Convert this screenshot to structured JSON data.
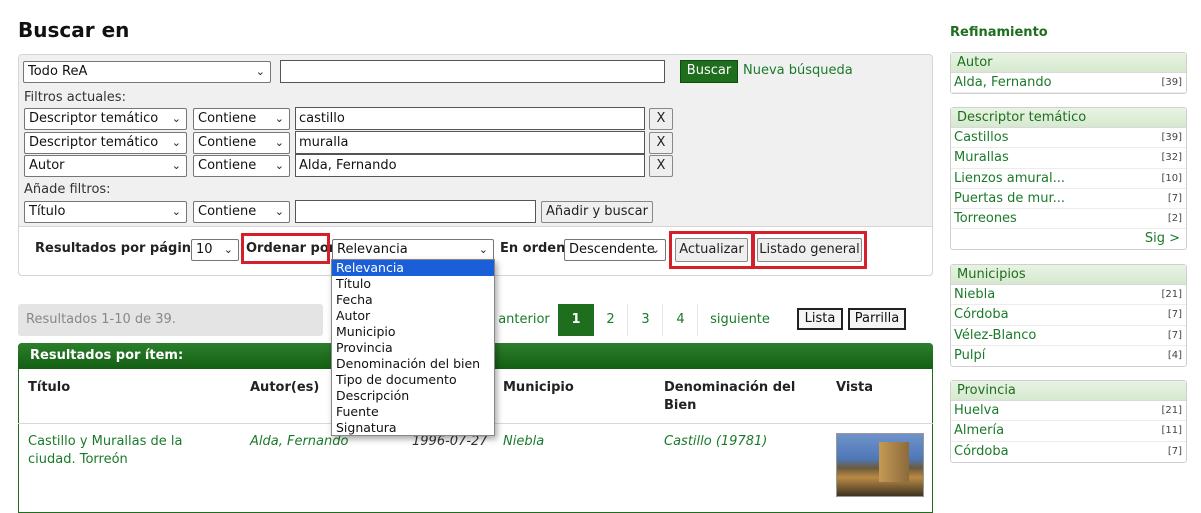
{
  "page": {
    "title": "Buscar en"
  },
  "search": {
    "scope": "Todo ReA",
    "query": "",
    "search_button": "Buscar",
    "new_search": "Nueva búsqueda"
  },
  "filters": {
    "current_label": "Filtros actuales:",
    "rows": [
      {
        "field": "Descriptor temático",
        "op": "Contiene",
        "value": "castillo",
        "remove": "X"
      },
      {
        "field": "Descriptor temático",
        "op": "Contiene",
        "value": "muralla",
        "remove": "X"
      },
      {
        "field": "Autor",
        "op": "Contiene",
        "value": "Alda, Fernando",
        "remove": "X"
      }
    ],
    "add_label": "Añade filtros:",
    "add_row": {
      "field": "Título",
      "op": "Contiene",
      "value": "",
      "button": "Añadir y buscar"
    }
  },
  "options": {
    "per_page_label": "Resultados por página",
    "per_page_value": "10",
    "sort_label": "Ordenar por",
    "sort_value": "Relevancia",
    "order_label": "En orden",
    "order_value": "Descendente",
    "update_button": "Actualizar",
    "general_list_button": "Listado general"
  },
  "sort_dropdown": {
    "options": [
      "Relevancia",
      "Título",
      "Fecha",
      "Autor",
      "Municipio",
      "Provincia",
      "Denominación del bien",
      "Tipo de documento",
      "Descripción",
      "Fuente",
      "Signatura"
    ],
    "selected_index": 0
  },
  "results": {
    "summary": "Resultados 1-10 de 39.",
    "pager": {
      "prev": "anterior",
      "pages": [
        "1",
        "2",
        "3",
        "4"
      ],
      "active": "1",
      "next": "siguiente"
    },
    "view_list": "Lista",
    "view_grid": "Parrilla",
    "header": "Resultados por ítem:",
    "columns": {
      "title": "Título",
      "author": "Autor(es)",
      "municipality": "Municipio",
      "denomination": "Denominación del Bien",
      "view": "Vista"
    },
    "rows": [
      {
        "title": "Castillo y Murallas de la ciudad. Torreón",
        "author": "Alda, Fernando",
        "date": "1996-07-27",
        "municipality": "Niebla",
        "denomination": "Castillo (19781)"
      }
    ]
  },
  "sidebar": {
    "title": "Refinamiento",
    "groups": [
      {
        "name": "Autor",
        "items": [
          {
            "label": "Alda, Fernando",
            "count": "[39]"
          }
        ]
      },
      {
        "name": "Descriptor temático",
        "items": [
          {
            "label": "Castillos",
            "count": "[39]"
          },
          {
            "label": "Murallas",
            "count": "[32]"
          },
          {
            "label": "Lienzos amural...",
            "count": "[10]"
          },
          {
            "label": "Puertas de mur...",
            "count": "[7]"
          },
          {
            "label": "Torreones",
            "count": "[2]"
          }
        ],
        "more": "Sig >"
      },
      {
        "name": "Municipios",
        "items": [
          {
            "label": "Niebla",
            "count": "[21]"
          },
          {
            "label": "Córdoba",
            "count": "[7]"
          },
          {
            "label": "Vélez-Blanco",
            "count": "[7]"
          },
          {
            "label": "Pulpí",
            "count": "[4]"
          }
        ]
      },
      {
        "name": "Provincia",
        "items": [
          {
            "label": "Huelva",
            "count": "[21]"
          },
          {
            "label": "Almería",
            "count": "[11]"
          },
          {
            "label": "Córdoba",
            "count": "[7]"
          }
        ]
      }
    ]
  },
  "colors": {
    "accent_green": "#1e6e1e",
    "link_green": "#1b7a2a",
    "highlight_red": "#d3202a",
    "selection_blue": "#1a5fd8"
  }
}
